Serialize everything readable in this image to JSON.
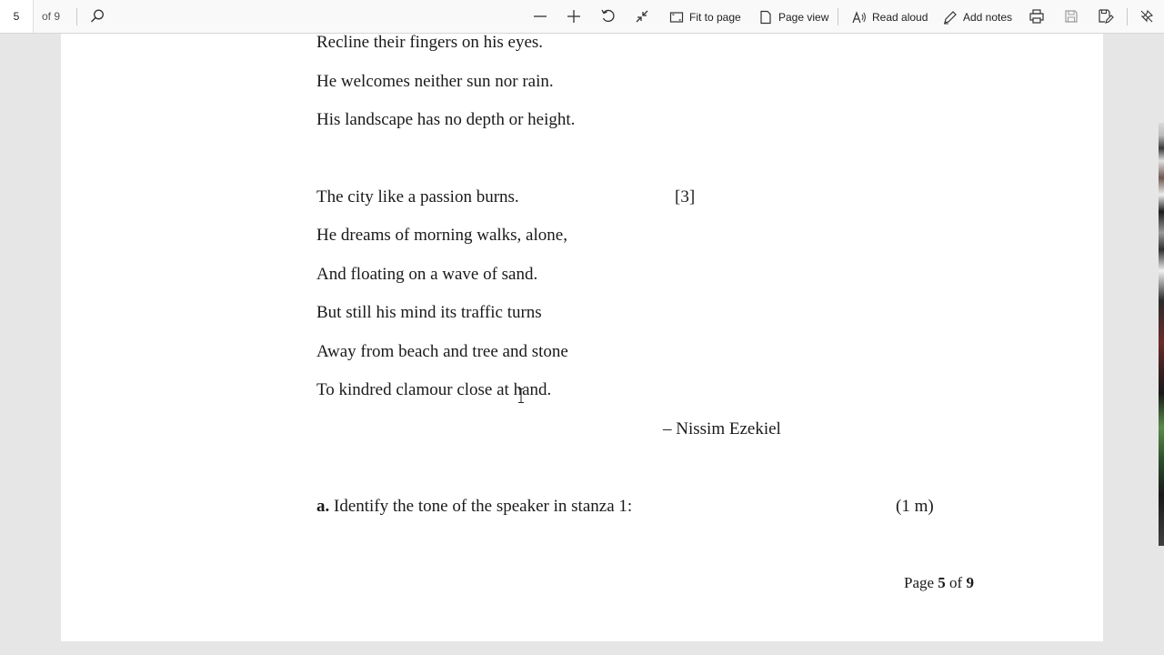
{
  "toolbar": {
    "page_number": "5",
    "page_total": "of 9",
    "fit_to_page": "Fit to page",
    "page_view": "Page view",
    "read_aloud": "Read aloud",
    "add_notes": "Add notes"
  },
  "poem": {
    "lines_top": [
      "Recline their fingers on his eyes.",
      "He welcomes neither sun nor rain.",
      "His landscape has no depth or height."
    ],
    "stanza_marker": "[3]",
    "lines_stanza3": [
      "The city like a passion burns.",
      "He dreams of morning walks, alone,",
      "And floating on a wave of sand.",
      "But still his mind its traffic turns",
      "Away from beach and tree and stone",
      "To kindred clamour close at hand."
    ],
    "author": "– Nissim Ezekiel"
  },
  "question": {
    "label": "a.",
    "text": " Identify the tone of the speaker in stanza 1:",
    "marks": "(1 m)"
  },
  "footer": {
    "prefix": "Page ",
    "current": "5",
    "middle": " of ",
    "total": "9"
  }
}
